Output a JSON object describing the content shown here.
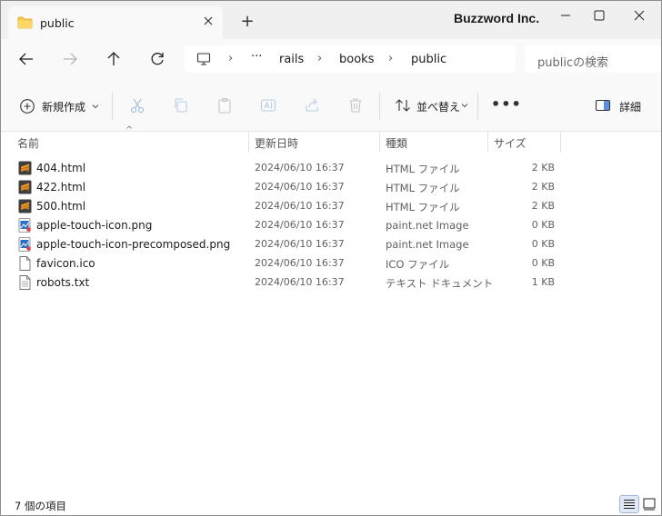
{
  "window": {
    "brand": "Buzzword Inc.",
    "tab_title": "public",
    "new_tab": "+"
  },
  "nav": {
    "breadcrumb": [
      "rails",
      "books",
      "public"
    ],
    "overflow": "···",
    "search_placeholder": "publicの検索"
  },
  "commands": {
    "new_label": "新規作成",
    "sort_label": "並べ替え",
    "details_label": "詳細",
    "more": "•••"
  },
  "columns": {
    "name": "名前",
    "modified": "更新日時",
    "type": "種類",
    "size": "サイズ"
  },
  "files": [
    {
      "name": "404.html",
      "modified": "2024/06/10 16:37",
      "type": "HTML ファイル",
      "size": "2 KB",
      "icon": "sublime-icon"
    },
    {
      "name": "422.html",
      "modified": "2024/06/10 16:37",
      "type": "HTML ファイル",
      "size": "2 KB",
      "icon": "sublime-icon"
    },
    {
      "name": "500.html",
      "modified": "2024/06/10 16:37",
      "type": "HTML ファイル",
      "size": "2 KB",
      "icon": "sublime-icon"
    },
    {
      "name": "apple-touch-icon.png",
      "modified": "2024/06/10 16:37",
      "type": "paint.net Image",
      "size": "0 KB",
      "icon": "paintnet-image-icon"
    },
    {
      "name": "apple-touch-icon-precomposed.png",
      "modified": "2024/06/10 16:37",
      "type": "paint.net Image",
      "size": "0 KB",
      "icon": "paintnet-image-icon"
    },
    {
      "name": "favicon.ico",
      "modified": "2024/06/10 16:37",
      "type": "ICO ファイル",
      "size": "0 KB",
      "icon": "blank-file-icon"
    },
    {
      "name": "robots.txt",
      "modified": "2024/06/10 16:37",
      "type": "テキスト ドキュメント",
      "size": "1 KB",
      "icon": "text-file-icon"
    }
  ],
  "status": {
    "item_count": "7 個の項目"
  },
  "colors": {
    "titlebar": "#f0f0f0",
    "toolbar": "#f9f9f9",
    "folder_yellow": "#f7c84a",
    "sublime_orange": "#f59a23"
  }
}
